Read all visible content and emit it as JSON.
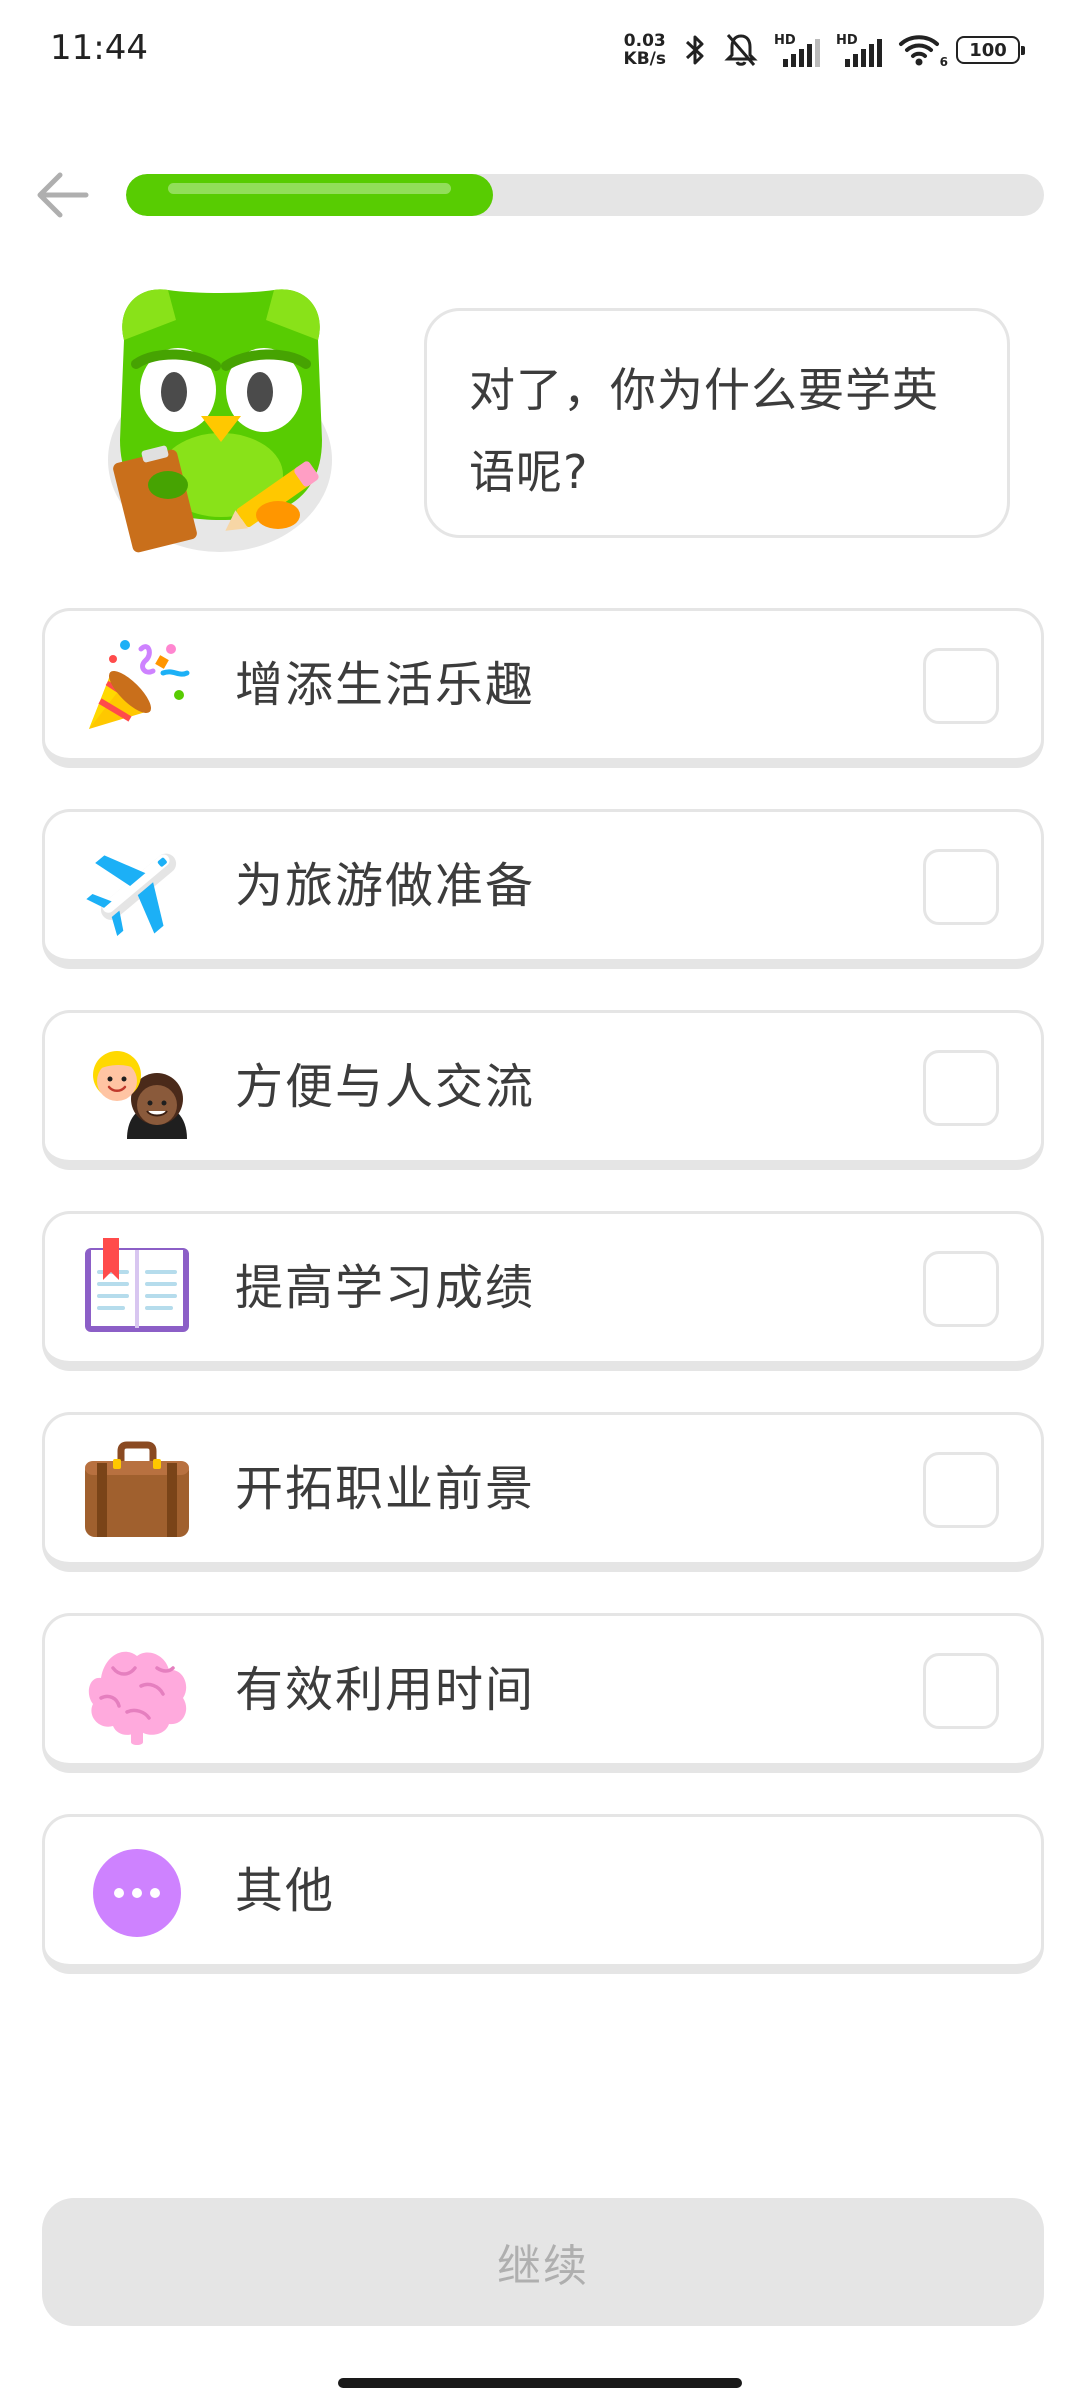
{
  "status_bar": {
    "time": "11:44",
    "net_speed_value": "0.03",
    "net_speed_unit": "KB/s",
    "sim1_label": "HD",
    "sim2_label": "HD",
    "wifi_sub": "6",
    "battery": "100",
    "icons": [
      "bluetooth-icon",
      "mute-icon",
      "signal-icon",
      "signal-icon",
      "wifi-icon",
      "battery-icon"
    ]
  },
  "header": {
    "back_icon": "arrow-left-icon",
    "progress_fraction": 0.4
  },
  "prompt": {
    "line1": "对了，你为什么要学英",
    "line2": "语呢?"
  },
  "options": [
    {
      "label": "增添生活乐趣",
      "icon": "party-popper-icon",
      "checked": false
    },
    {
      "label": "为旅游做准备",
      "icon": "airplane-icon",
      "checked": false
    },
    {
      "label": "方便与人交流",
      "icon": "people-icon",
      "checked": false
    },
    {
      "label": "提高学习成绩",
      "icon": "book-icon",
      "checked": false
    },
    {
      "label": "开拓职业前景",
      "icon": "briefcase-icon",
      "checked": false
    },
    {
      "label": "有效利用时间",
      "icon": "brain-icon",
      "checked": false
    },
    {
      "label": "其他",
      "icon": "more-dots-icon"
    }
  ],
  "continue_label": "继续",
  "colors": {
    "progress": "#58cc02",
    "border": "#e5e5e5",
    "disabled_button": "#e5e5e5",
    "disabled_text": "#afafaf"
  }
}
